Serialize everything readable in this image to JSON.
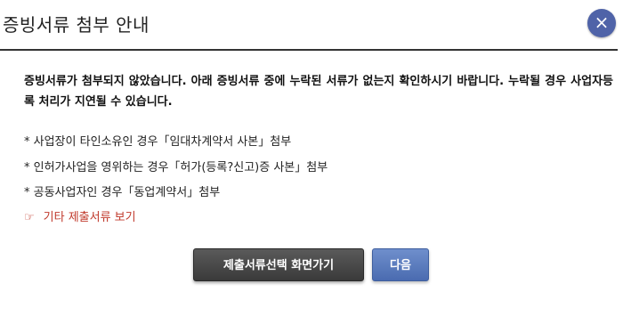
{
  "dialog": {
    "title": "증빙서류 첨부 안내",
    "close_glyph": "×"
  },
  "body": {
    "notice": "증빙서류가 첨부되지 않았습니다. 아래 증빙서류 중에 누락된 서류가 없는지 확인하시기 바랍니다. 누락될 경우 사업자등록 처리가 지연될 수 있습니다.",
    "requirements": [
      "* 사업장이 타인소유인 경우「임대차계약서 사본」첨부",
      "* 인허가사업을 영위하는 경우「허가(등록?신고)증 사본」첨부",
      "* 공동사업자인 경우「동업계약서」첨부"
    ],
    "other_docs_icon": "☞",
    "other_docs_link": "기타 제출서류 보기"
  },
  "buttons": {
    "goto_selection": "제출서류선택 화면가기",
    "next": "다음"
  },
  "colors": {
    "close_button": "#4f63a8",
    "link": "#c0392b",
    "dark_button": "#444444",
    "blue_button": "#5a7bbf"
  }
}
